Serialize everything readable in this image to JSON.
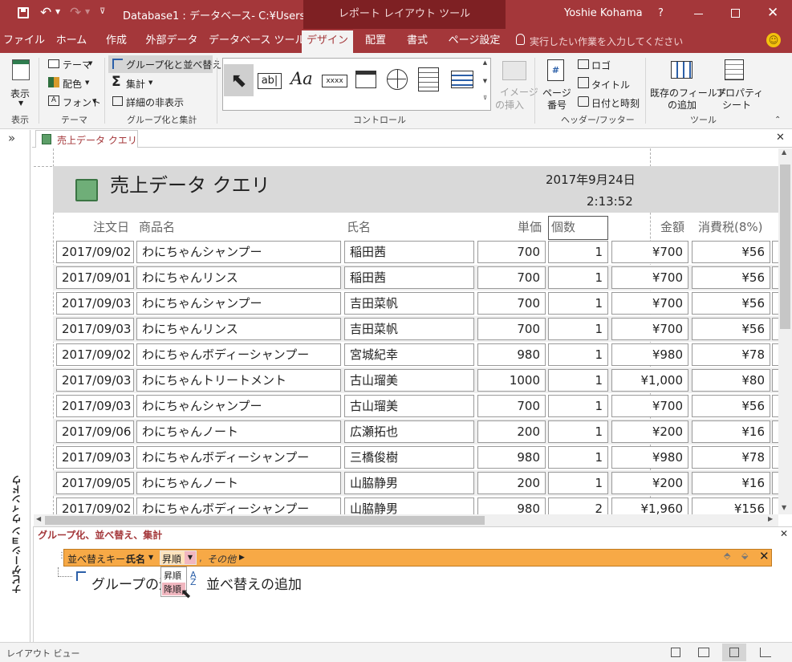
{
  "titlebar": {
    "title": "Database1 : データベース- C:¥Users…",
    "context_tool": "レポート レイアウト ツール",
    "user": "Yoshie Kohama",
    "help": "?"
  },
  "tabs": [
    "ファイル",
    "ホーム",
    "作成",
    "外部データ",
    "データベース ツール",
    "デザイン",
    "配置",
    "書式",
    "ページ設定"
  ],
  "tell_me": "実行したい作業を入力してください",
  "ribbon": {
    "view": {
      "label": "表示",
      "group": "表示"
    },
    "theme": {
      "themes": "テーマ",
      "colors": "配色",
      "fonts": "フォント",
      "group": "テーマ"
    },
    "grouping": {
      "group_sort": "グループ化と並べ替え",
      "totals": "集計",
      "hide_details": "詳細の非表示",
      "group": "グループ化と集計"
    },
    "controls": {
      "insert_image": "イメージの挿入",
      "insert_image_l1": "イメージ",
      "insert_image_l2": "の挿入",
      "group": "コントロール",
      "textbox": "ab|",
      "label": "Aa",
      "button": "xxxx"
    },
    "header_footer": {
      "page_number_l1": "ページ",
      "page_number_l2": "番号",
      "logo": "ロゴ",
      "title": "タイトル",
      "date_time": "日付と時刻",
      "group": "ヘッダー/フッター"
    },
    "tools": {
      "add_fields_l1": "既存のフィールド",
      "add_fields_l2": "の追加",
      "property_l1": "プロパティ",
      "property_l2": "シート",
      "group": "ツール"
    }
  },
  "nav_pane": {
    "label": "ナビゲーション ウィンドウ",
    "toggle": "»"
  },
  "document": {
    "tab": "売上データ クエリ"
  },
  "report": {
    "title": "売上データ クエリ",
    "date": "2017年9月24日",
    "time": "2:13:52",
    "columns": [
      "注文日",
      "商品名",
      "氏名",
      "単価",
      "個数",
      "金額",
      "消費税(8%)"
    ],
    "rows": [
      [
        "2017/09/02",
        "わにちゃんシャンプー",
        "稲田茜",
        "700",
        "1",
        "¥700",
        "¥56"
      ],
      [
        "2017/09/01",
        "わにちゃんリンス",
        "稲田茜",
        "700",
        "1",
        "¥700",
        "¥56"
      ],
      [
        "2017/09/03",
        "わにちゃんシャンプー",
        "吉田菜帆",
        "700",
        "1",
        "¥700",
        "¥56"
      ],
      [
        "2017/09/03",
        "わにちゃんリンス",
        "吉田菜帆",
        "700",
        "1",
        "¥700",
        "¥56"
      ],
      [
        "2017/09/02",
        "わにちゃんボディーシャンプー",
        "宮城紀幸",
        "980",
        "1",
        "¥980",
        "¥78"
      ],
      [
        "2017/09/03",
        "わにちゃんトリートメント",
        "古山瑠美",
        "1000",
        "1",
        "¥1,000",
        "¥80"
      ],
      [
        "2017/09/03",
        "わにちゃんシャンプー",
        "古山瑠美",
        "700",
        "1",
        "¥700",
        "¥56"
      ],
      [
        "2017/09/06",
        "わにちゃんノート",
        "広瀬拓也",
        "200",
        "1",
        "¥200",
        "¥16"
      ],
      [
        "2017/09/03",
        "わにちゃんボディーシャンプー",
        "三橋俊樹",
        "980",
        "1",
        "¥980",
        "¥78"
      ],
      [
        "2017/09/05",
        "わにちゃんノート",
        "山脇静男",
        "200",
        "1",
        "¥200",
        "¥16"
      ],
      [
        "2017/09/02",
        "わにちゃんボディーシャンプー",
        "山脇静男",
        "980",
        "2",
        "¥1,960",
        "¥156"
      ]
    ]
  },
  "group_panel": {
    "title": "グループ化、並べ替え、集計",
    "sort_prefix": "並べ替えキー:",
    "sort_field": "氏名",
    "sort_order": "昇順",
    "more": "その他",
    "dropdown_options": [
      "昇順",
      "降順"
    ],
    "add_group": "グループの追加",
    "add_sort": "並べ替えの追加"
  },
  "status": {
    "text": "レイアウト ビュー"
  },
  "colors": {
    "accent": "#a4373a",
    "sortbar": "#f7a946"
  }
}
